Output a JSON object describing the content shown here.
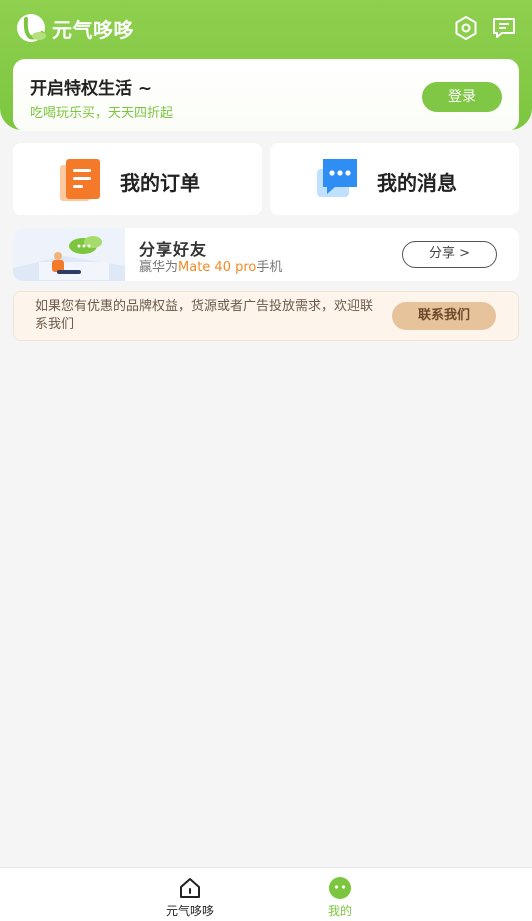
{
  "header": {
    "app_name": "元气哆哆",
    "icons": [
      "settings-icon",
      "message-icon"
    ],
    "accent_color": "#7cc63f"
  },
  "member_card": {
    "title": "开启特权生活 ~",
    "subtitle": "吃喝玩乐买，天天四折起",
    "login_label": "登录"
  },
  "quick_actions": [
    {
      "label": "我的订单",
      "icon": "orders-icon",
      "color": "#f47a2a"
    },
    {
      "label": "我的消息",
      "icon": "messages-icon",
      "color": "#2f8ef4"
    }
  ],
  "share_banner": {
    "title": "分享好友",
    "subtitle_prefix": "赢华为",
    "subtitle_highlight": "Mate 40 pro",
    "subtitle_suffix": "手机",
    "button_label": "分享 >"
  },
  "contact": {
    "text": "如果您有优惠的品牌权益，货源或者广告投放需求，欢迎联系我们",
    "button_label": "联系我们"
  },
  "tabbar": {
    "tabs": [
      {
        "label": "元气哆哆",
        "icon": "home-icon",
        "active": false,
        "color": "#222222"
      },
      {
        "label": "我的",
        "icon": "profile-face-icon",
        "active": true,
        "color": "#7cc63f"
      }
    ]
  }
}
